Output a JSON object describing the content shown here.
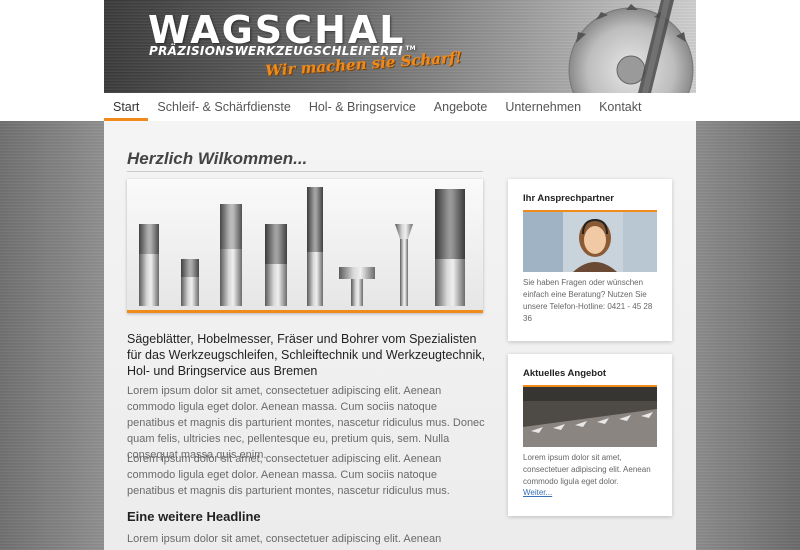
{
  "header": {
    "logo": "WAGSCHAL",
    "logo_tm": "TM",
    "subtitle": "PRÄZISIONSWERKZEUGSCHLEIFEREI",
    "slogan": "Wir machen sie Scharf!"
  },
  "nav": {
    "items": [
      {
        "label": "Start",
        "active": true
      },
      {
        "label": "Schleif- & Schärfdienste",
        "active": false
      },
      {
        "label": "Hol- & Bringservice",
        "active": false
      },
      {
        "label": "Angebote",
        "active": false
      },
      {
        "label": "Unternehmen",
        "active": false
      },
      {
        "label": "Kontakt",
        "active": false
      }
    ]
  },
  "main": {
    "title": "Herzlich Wilkommen...",
    "lead": "Sägeblätter, Hobelmesser, Fräser und Bohrer vom Spezialisten für das Werkzeugschleifen, Schleiftechnik und Werkzeugtechnik, Hol- und Bringservice aus Bremen",
    "paragraph1": "Lorem ipsum dolor sit amet, consectetuer adipiscing elit. Aenean commodo ligula eget dolor. Aenean massa. Cum sociis natoque penatibus et magnis dis parturient montes, nascetur ridiculus mus. Donec quam felis, ultricies nec, pellentesque eu, pretium quis, sem. Nulla consequat massa quis enim.",
    "paragraph2": "Lorem ipsum dolor sit amet, consectetuer adipiscing elit. Aenean commodo ligula eget dolor. Aenean massa. Cum sociis natoque penatibus et magnis dis parturient montes, nascetur ridiculus mus.",
    "headline2": "Eine weitere Headline",
    "paragraph3": "Lorem ipsum dolor sit amet, consectetuer adipiscing elit. Aenean commodo"
  },
  "sidebar": {
    "contact": {
      "title": "Ihr Ansprechpartner",
      "text": "Sie haben Fragen oder wünschen einfach eine Beratung? Nutzen Sie unsere Telefon-Hotline: 0421 - 45 28 36"
    },
    "offer": {
      "title": "Aktuelles Angebot",
      "text": "Lorem ipsum dolor sit amet, consectetuer adipiscing elit. Aenean commodo ligula eget dolor.",
      "link": "Weiter..."
    }
  },
  "colors": {
    "accent": "#f08a1a",
    "link": "#3a6fb3"
  }
}
